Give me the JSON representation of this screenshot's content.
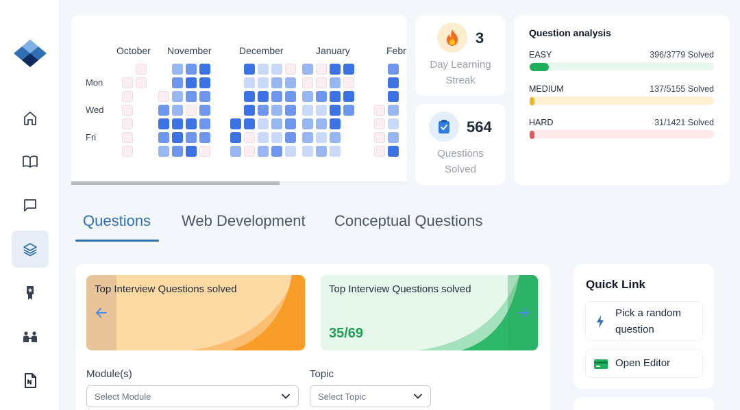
{
  "sidebar": {
    "items": [
      {
        "name": "home"
      },
      {
        "name": "book"
      },
      {
        "name": "chat"
      },
      {
        "name": "layers"
      },
      {
        "name": "award"
      },
      {
        "name": "community"
      },
      {
        "name": "notebook"
      }
    ],
    "active_item": "layers"
  },
  "heatmap": {
    "months": [
      "October",
      "November",
      "December",
      "January",
      "Febr"
    ],
    "day_labels": [
      "Mon",
      "Wed",
      "Fri"
    ],
    "scroll_position": 0.62,
    "columns": [
      [
        -1,
        0,
        0,
        0,
        0,
        0,
        0
      ],
      [
        0,
        0,
        -1,
        -1,
        -1,
        -1,
        -1
      ],
      [
        -1,
        -1,
        0,
        3,
        4,
        3,
        2
      ],
      [
        2,
        3,
        2,
        2,
        4,
        4,
        3
      ],
      [
        3,
        4,
        3,
        0,
        4,
        3,
        4
      ],
      [
        4,
        4,
        3,
        3,
        3,
        3,
        0
      ],
      [
        -1,
        -1,
        -1,
        -1,
        4,
        4,
        2
      ],
      [
        4,
        1,
        4,
        4,
        4,
        0,
        0
      ],
      [
        1,
        1,
        4,
        3,
        1,
        1,
        2
      ],
      [
        1,
        2,
        3,
        2,
        2,
        1,
        3
      ],
      [
        0,
        2,
        3,
        3,
        3,
        3,
        1
      ],
      [
        2,
        0,
        2,
        1,
        2,
        2,
        1
      ],
      [
        0,
        0,
        3,
        1,
        2,
        1,
        2
      ],
      [
        4,
        2,
        4,
        4,
        4,
        2,
        1
      ],
      [
        4,
        0,
        4,
        3,
        -1,
        -1,
        -1
      ],
      [
        -1,
        -1,
        -1,
        0,
        0,
        0,
        0
      ],
      [
        3,
        4,
        4,
        2,
        1,
        2,
        4
      ]
    ]
  },
  "streak": {
    "value": "3",
    "label": "Day Learning Streak",
    "icon": "fire-icon"
  },
  "solved": {
    "value": "564",
    "label": "Questions Solved",
    "icon": "clipboard-check-icon"
  },
  "analysis": {
    "title": "Question analysis",
    "levels": [
      {
        "name": "EASY",
        "count": "396/3779 Solved",
        "fraction": 0.105,
        "color": "#1fae5b",
        "track": "#e9f8ee"
      },
      {
        "name": "MEDIUM",
        "count": "137/5155 Solved",
        "fraction": 0.027,
        "color": "#f0b528",
        "track": "#fdf1d2"
      },
      {
        "name": "HARD",
        "count": "31/1421 Solved",
        "fraction": 0.022,
        "color": "#e15a5a",
        "track": "#fce8e8"
      }
    ]
  },
  "tabs": [
    {
      "label": "Questions",
      "active": true
    },
    {
      "label": "Web Development",
      "active": false
    },
    {
      "label": "Conceptual Questions",
      "active": false
    }
  ],
  "promos": [
    {
      "title": "Top Interview Questions solved",
      "count": ""
    },
    {
      "title": "Top Interview Questions solved",
      "count": "35/69"
    }
  ],
  "filters": {
    "module_label": "Module(s)",
    "module_placeholder": "Select Module",
    "topic_label": "Topic",
    "topic_placeholder": "Select Topic"
  },
  "quick_link": {
    "title": "Quick Link",
    "items": [
      {
        "label": "Pick a random question",
        "icon": "bolt-icon"
      },
      {
        "label": "Open Editor",
        "icon": "card-icon"
      }
    ]
  },
  "colors": {
    "accent": "#2f6fb3",
    "heat_levels": [
      "#fbeff2",
      "#c9d9f7",
      "#98b6f2",
      "#6d96ec",
      "#3c72e4"
    ]
  }
}
